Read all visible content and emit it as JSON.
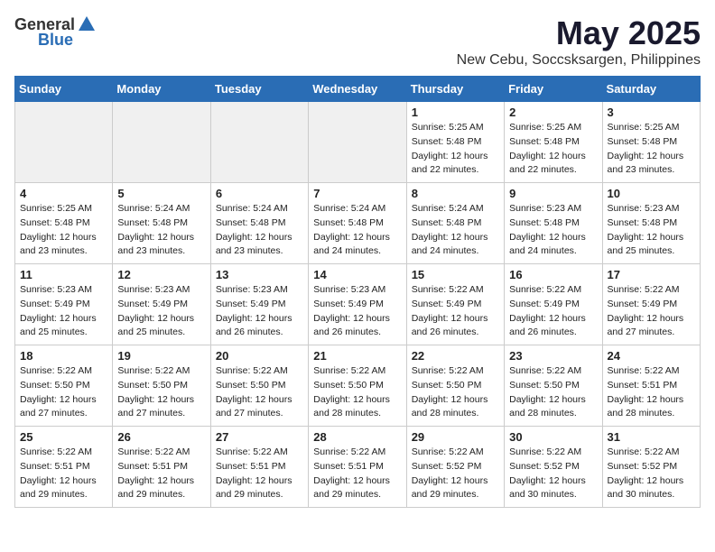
{
  "logo": {
    "general": "General",
    "blue": "Blue"
  },
  "title": "May 2025",
  "location": "New Cebu, Soccsksargen, Philippines",
  "days_header": [
    "Sunday",
    "Monday",
    "Tuesday",
    "Wednesday",
    "Thursday",
    "Friday",
    "Saturday"
  ],
  "weeks": [
    [
      {
        "day": "",
        "info": ""
      },
      {
        "day": "",
        "info": ""
      },
      {
        "day": "",
        "info": ""
      },
      {
        "day": "",
        "info": ""
      },
      {
        "day": "1",
        "info": "Sunrise: 5:25 AM\nSunset: 5:48 PM\nDaylight: 12 hours\nand 22 minutes."
      },
      {
        "day": "2",
        "info": "Sunrise: 5:25 AM\nSunset: 5:48 PM\nDaylight: 12 hours\nand 22 minutes."
      },
      {
        "day": "3",
        "info": "Sunrise: 5:25 AM\nSunset: 5:48 PM\nDaylight: 12 hours\nand 23 minutes."
      }
    ],
    [
      {
        "day": "4",
        "info": "Sunrise: 5:25 AM\nSunset: 5:48 PM\nDaylight: 12 hours\nand 23 minutes."
      },
      {
        "day": "5",
        "info": "Sunrise: 5:24 AM\nSunset: 5:48 PM\nDaylight: 12 hours\nand 23 minutes."
      },
      {
        "day": "6",
        "info": "Sunrise: 5:24 AM\nSunset: 5:48 PM\nDaylight: 12 hours\nand 23 minutes."
      },
      {
        "day": "7",
        "info": "Sunrise: 5:24 AM\nSunset: 5:48 PM\nDaylight: 12 hours\nand 24 minutes."
      },
      {
        "day": "8",
        "info": "Sunrise: 5:24 AM\nSunset: 5:48 PM\nDaylight: 12 hours\nand 24 minutes."
      },
      {
        "day": "9",
        "info": "Sunrise: 5:23 AM\nSunset: 5:48 PM\nDaylight: 12 hours\nand 24 minutes."
      },
      {
        "day": "10",
        "info": "Sunrise: 5:23 AM\nSunset: 5:48 PM\nDaylight: 12 hours\nand 25 minutes."
      }
    ],
    [
      {
        "day": "11",
        "info": "Sunrise: 5:23 AM\nSunset: 5:49 PM\nDaylight: 12 hours\nand 25 minutes."
      },
      {
        "day": "12",
        "info": "Sunrise: 5:23 AM\nSunset: 5:49 PM\nDaylight: 12 hours\nand 25 minutes."
      },
      {
        "day": "13",
        "info": "Sunrise: 5:23 AM\nSunset: 5:49 PM\nDaylight: 12 hours\nand 26 minutes."
      },
      {
        "day": "14",
        "info": "Sunrise: 5:23 AM\nSunset: 5:49 PM\nDaylight: 12 hours\nand 26 minutes."
      },
      {
        "day": "15",
        "info": "Sunrise: 5:22 AM\nSunset: 5:49 PM\nDaylight: 12 hours\nand 26 minutes."
      },
      {
        "day": "16",
        "info": "Sunrise: 5:22 AM\nSunset: 5:49 PM\nDaylight: 12 hours\nand 26 minutes."
      },
      {
        "day": "17",
        "info": "Sunrise: 5:22 AM\nSunset: 5:49 PM\nDaylight: 12 hours\nand 27 minutes."
      }
    ],
    [
      {
        "day": "18",
        "info": "Sunrise: 5:22 AM\nSunset: 5:50 PM\nDaylight: 12 hours\nand 27 minutes."
      },
      {
        "day": "19",
        "info": "Sunrise: 5:22 AM\nSunset: 5:50 PM\nDaylight: 12 hours\nand 27 minutes."
      },
      {
        "day": "20",
        "info": "Sunrise: 5:22 AM\nSunset: 5:50 PM\nDaylight: 12 hours\nand 27 minutes."
      },
      {
        "day": "21",
        "info": "Sunrise: 5:22 AM\nSunset: 5:50 PM\nDaylight: 12 hours\nand 28 minutes."
      },
      {
        "day": "22",
        "info": "Sunrise: 5:22 AM\nSunset: 5:50 PM\nDaylight: 12 hours\nand 28 minutes."
      },
      {
        "day": "23",
        "info": "Sunrise: 5:22 AM\nSunset: 5:50 PM\nDaylight: 12 hours\nand 28 minutes."
      },
      {
        "day": "24",
        "info": "Sunrise: 5:22 AM\nSunset: 5:51 PM\nDaylight: 12 hours\nand 28 minutes."
      }
    ],
    [
      {
        "day": "25",
        "info": "Sunrise: 5:22 AM\nSunset: 5:51 PM\nDaylight: 12 hours\nand 29 minutes."
      },
      {
        "day": "26",
        "info": "Sunrise: 5:22 AM\nSunset: 5:51 PM\nDaylight: 12 hours\nand 29 minutes."
      },
      {
        "day": "27",
        "info": "Sunrise: 5:22 AM\nSunset: 5:51 PM\nDaylight: 12 hours\nand 29 minutes."
      },
      {
        "day": "28",
        "info": "Sunrise: 5:22 AM\nSunset: 5:51 PM\nDaylight: 12 hours\nand 29 minutes."
      },
      {
        "day": "29",
        "info": "Sunrise: 5:22 AM\nSunset: 5:52 PM\nDaylight: 12 hours\nand 29 minutes."
      },
      {
        "day": "30",
        "info": "Sunrise: 5:22 AM\nSunset: 5:52 PM\nDaylight: 12 hours\nand 30 minutes."
      },
      {
        "day": "31",
        "info": "Sunrise: 5:22 AM\nSunset: 5:52 PM\nDaylight: 12 hours\nand 30 minutes."
      }
    ]
  ]
}
